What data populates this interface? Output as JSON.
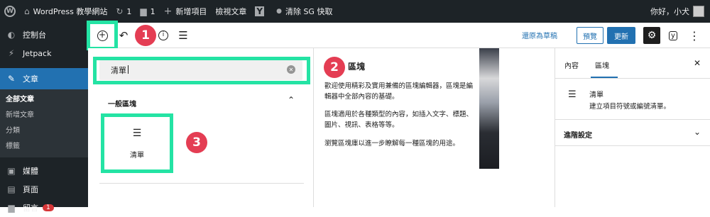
{
  "admin_bar": {
    "site_name": "WordPress 教學網站",
    "updates_count": "1",
    "comments_count": "1",
    "new_item": "新增項目",
    "view_post": "檢視文章",
    "purge_cache": "清除 SG 快取",
    "greeting": "你好，小犬"
  },
  "sidebar": {
    "items": [
      {
        "label": "控制台",
        "icon": "dashboard-icon"
      },
      {
        "label": "Jetpack",
        "icon": "jetpack-icon"
      },
      {
        "label": "文章",
        "icon": "pin-icon"
      }
    ],
    "posts_submenu": [
      "全部文章",
      "新增文章",
      "分類",
      "標籤"
    ],
    "items_after": [
      {
        "label": "媒體",
        "icon": "media-icon"
      },
      {
        "label": "頁面",
        "icon": "page-icon"
      },
      {
        "label": "留言",
        "icon": "comment-icon",
        "badge": "1"
      }
    ]
  },
  "toolbar": {
    "save_draft": "還原為草稿",
    "preview": "預覽",
    "update": "更新"
  },
  "inserter": {
    "search_value": "清單",
    "category": "一般區塊",
    "block_label": "清單"
  },
  "block_preview": {
    "title": "區塊",
    "p1": "歡迎使用精彩及實用兼備的區塊編輯器，區塊是編輯器中全部內容的基礎。",
    "p2": "區塊適用於各種類型的內容，如插入文字、標題、圖片、視訊、表格等等。",
    "p3": "瀏覽區塊庫以進一步瞭解每一種區塊的用途。"
  },
  "settings": {
    "tab_content": "內容",
    "tab_block": "區塊",
    "block_title": "清單",
    "block_desc": "建立項目符號或編號清單。",
    "advanced": "進階設定"
  },
  "annotations": [
    "1",
    "2",
    "3"
  ],
  "colors": {
    "highlight": "#24e3a4",
    "badge": "#e43d53",
    "accent": "#2271b1"
  }
}
